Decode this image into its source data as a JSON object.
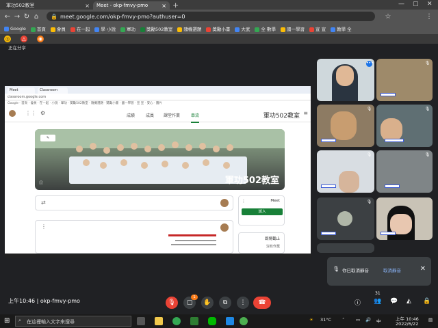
{
  "browser": {
    "tabs": [
      {
        "label": "軍功502教室"
      },
      {
        "label": "Meet - okp-fmvy-pmo"
      }
    ],
    "new_tab": "+",
    "url": "meet.google.com/okp-fmvy-pmo?authuser=0",
    "bookmarks": [
      "Google",
      "首頁",
      "會員",
      "在一起",
      "學 小說",
      "軍功",
      "獎勵502教室",
      "隨機選題",
      "獎勵小書",
      "大武",
      "全 數學",
      "國一學習",
      "宣 宣",
      "教學 全",
      "安心",
      "圖片"
    ],
    "window_controls": {
      "min": "—",
      "max": "▢",
      "close": "✕"
    }
  },
  "presenter_label": "正在分享",
  "shared_screen": {
    "class_name": "軍功502教室",
    "nav": [
      "串流",
      "課堂作業",
      "成員",
      "成績"
    ],
    "banner_title": "軍功502教室",
    "meet_box": {
      "title": "Meet",
      "join": "加入"
    },
    "upcoming": {
      "title": "即將截止",
      "text": "沒有作業"
    }
  },
  "tiles": [
    {
      "name": "teacher"
    },
    {
      "name": "p2"
    },
    {
      "name": "p3"
    },
    {
      "name": "p4"
    },
    {
      "name": "p5"
    },
    {
      "name": "p6"
    },
    {
      "name": "p7"
    },
    {
      "name": "p8"
    },
    {
      "name": "p9"
    },
    {
      "name": "p10"
    }
  ],
  "notification": {
    "text": "你已取消靜音",
    "link": "取消靜音"
  },
  "meet_bar": {
    "time": "上午10:46",
    "separator": "|",
    "code": "okp-fmvy-pmo",
    "participants_count": "31",
    "raise_hand_badge": "1"
  },
  "taskbar": {
    "search_placeholder": "在這裡輸入文字來搜尋",
    "temperature": "31°C",
    "ime": "中",
    "clock_time": "上午 10:46",
    "clock_date": "2022/6/22"
  }
}
